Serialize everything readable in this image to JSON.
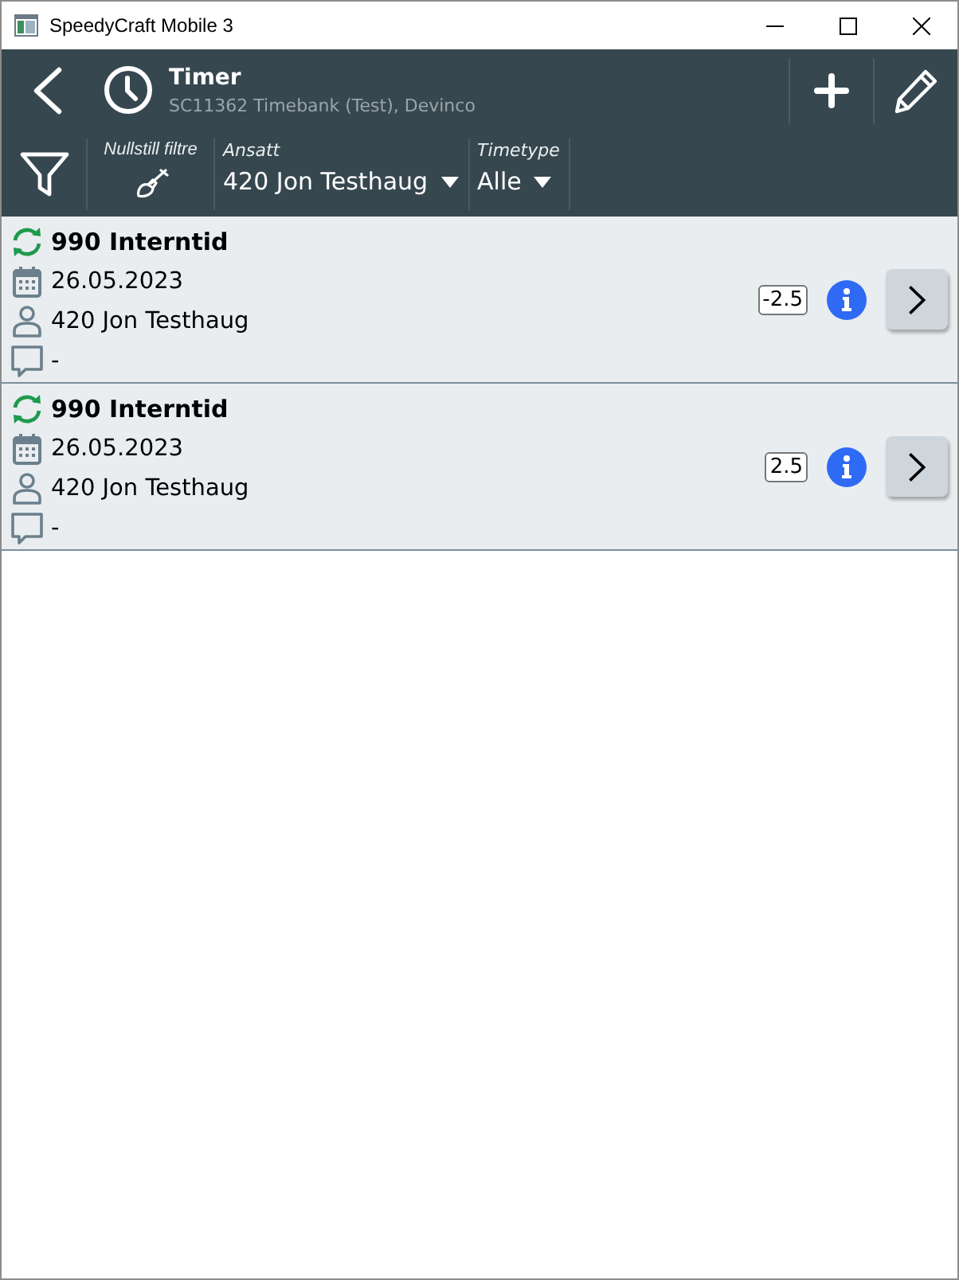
{
  "window": {
    "title": "SpeedyCraft Mobile 3"
  },
  "header": {
    "title": "Timer",
    "subtitle": "SC11362 Timebank (Test), Devinco"
  },
  "filters": {
    "reset": {
      "label": "Nullstill filtre"
    },
    "dropdowns": [
      {
        "label": "Ansatt",
        "value": "420 Jon Testhaug"
      },
      {
        "label": "Timetype",
        "value": "Alle"
      }
    ]
  },
  "entries": [
    {
      "title": "990 Interntid",
      "date": "26.05.2023",
      "employee": "420 Jon Testhaug",
      "comment": "-",
      "hours": "-2.5"
    },
    {
      "title": "990 Interntid",
      "date": "26.05.2023",
      "employee": "420 Jon Testhaug",
      "comment": "-",
      "hours": "2.5"
    }
  ]
}
